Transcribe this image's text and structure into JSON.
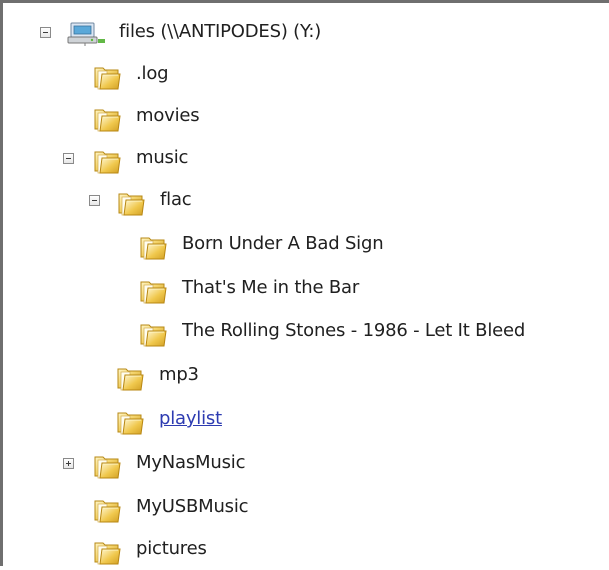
{
  "tree": {
    "root": {
      "label": "files (\\\\ANTIPODES) (Y:)",
      "icon": "network-drive-icon",
      "expanded": true
    },
    "items": [
      {
        "label": ".log",
        "icon": "folder-icon",
        "expanded": null
      },
      {
        "label": "movies",
        "icon": "folder-icon",
        "expanded": null
      },
      {
        "label": "music",
        "icon": "folder-icon",
        "expanded": true
      },
      {
        "label": "flac",
        "icon": "folder-icon",
        "expanded": true
      },
      {
        "label": "Born Under A Bad Sign",
        "icon": "folder-icon",
        "expanded": null
      },
      {
        "label": "That's Me in the Bar",
        "icon": "folder-icon",
        "expanded": null
      },
      {
        "label": "The Rolling Stones - 1986 - Let It Bleed",
        "icon": "folder-icon",
        "expanded": null
      },
      {
        "label": "mp3",
        "icon": "folder-icon",
        "expanded": null
      },
      {
        "label": "playlist",
        "icon": "folder-icon",
        "expanded": null,
        "state": "hover-link"
      },
      {
        "label": "MyNasMusic",
        "icon": "folder-icon",
        "expanded": false
      },
      {
        "label": "MyUSBMusic",
        "icon": "folder-icon",
        "expanded": null
      },
      {
        "label": "pictures",
        "icon": "folder-icon",
        "expanded": null
      }
    ]
  },
  "colors": {
    "frame": "#6f6f6f",
    "folder_light": "#fff1a8",
    "folder_mid": "#f0c84d",
    "folder_dark": "#c79516",
    "link": "#2d3bb1",
    "drive_green": "#5db93b"
  }
}
